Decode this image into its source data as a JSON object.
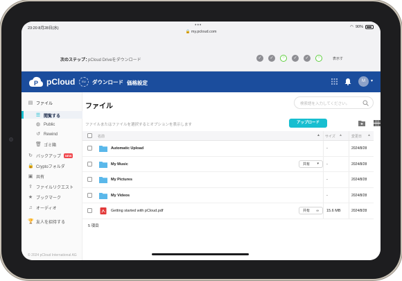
{
  "status_bar": {
    "time": "23:20  8月28日(水)",
    "url": "my.pcloud.com",
    "battery": "90%"
  },
  "onboarding": {
    "label": "次のステップ：",
    "text": "pCloud Driveをダウンロード",
    "steps": [
      {
        "state": "done",
        "glyph": "✓"
      },
      {
        "state": "done",
        "glyph": "✓"
      },
      {
        "state": "open",
        "glyph": "○"
      },
      {
        "state": "done",
        "glyph": "✓"
      },
      {
        "state": "done",
        "glyph": "✓"
      },
      {
        "state": "open",
        "glyph": "○"
      }
    ],
    "skip": "表示す"
  },
  "header": {
    "brand": "pCloud",
    "download": "ダウンロード",
    "pricing": "価格設定",
    "avatar_initial": "M",
    "dl_badge": "EU"
  },
  "sidebar": {
    "files": "ファイル",
    "browse": "閲覧する",
    "public": "Public",
    "rewind": "Rewind",
    "trash": "ゴミ箱",
    "backup": "バックアップ",
    "new_badge": "NEW",
    "crypto": "Cryptoフォルダ",
    "shared": "共有",
    "file_requests": "ファイルリクエスト",
    "bookmarks": "ブックマーク",
    "audio": "オーディオ",
    "invite": "友人を招待する",
    "copyright": "© 2024 pCloud International AG",
    "more": "•••"
  },
  "main": {
    "title": "ファイル",
    "search_placeholder": "検索語を入力してください。",
    "hint": "ファイルまたはファイルを選択するとオプションを表示します",
    "upload": "アップロード",
    "columns": {
      "name": "名前",
      "size": "サイズ",
      "date": "変更日"
    },
    "rows": [
      {
        "name": "Automatic Upload",
        "size": "-",
        "date": "2024/8/28",
        "share": ""
      },
      {
        "name": "My Music",
        "size": "-",
        "date": "2024/8/28",
        "share": "共有"
      },
      {
        "name": "My Pictures",
        "size": "-",
        "date": "2024/8/28",
        "share": ""
      },
      {
        "name": "My Videos",
        "size": "-",
        "date": "2024/8/28",
        "share": ""
      },
      {
        "name": "Getting started with pCloud.pdf",
        "size": "15.6 MB",
        "date": "2024/8/28",
        "share": "共有"
      }
    ],
    "count": "5 項目"
  },
  "colors": {
    "brand_blue": "#1b4d9d",
    "accent_cyan": "#17bed0",
    "folder": "#5ab8ea",
    "pdf_red": "#e23a3a"
  }
}
